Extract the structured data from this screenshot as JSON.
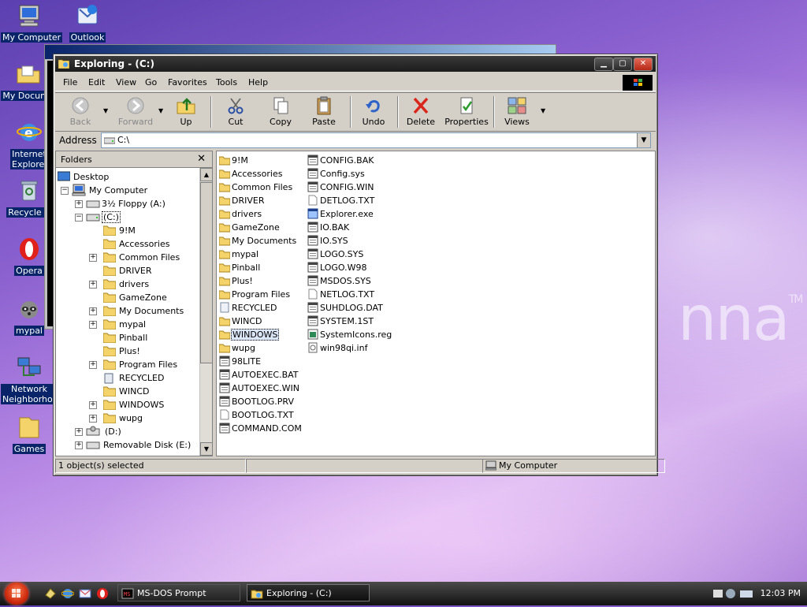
{
  "brand": {
    "text": "nna",
    "tm": "TM"
  },
  "desktop_icons": [
    {
      "label": "My Computer"
    },
    {
      "label": "Outlook"
    },
    {
      "label": "My Docume"
    },
    {
      "label": "Internet Explorer"
    },
    {
      "label": "Recycle B"
    },
    {
      "label": "Opera"
    },
    {
      "label": "mypal"
    },
    {
      "label": "Network Neighborhood"
    },
    {
      "label": "Games"
    }
  ],
  "explorer": {
    "title": "Exploring - (C:)",
    "menu": [
      "File",
      "Edit",
      "View",
      "Go",
      "Favorites",
      "Tools",
      "Help"
    ],
    "toolbar": {
      "back": "Back",
      "forward": "Forward",
      "up": "Up",
      "cut": "Cut",
      "copy": "Copy",
      "paste": "Paste",
      "undo": "Undo",
      "delete": "Delete",
      "properties": "Properties",
      "views": "Views"
    },
    "address": {
      "label": "Address",
      "value": "C:\\"
    },
    "folders_header": "Folders",
    "tree": {
      "desktop": "Desktop",
      "my_computer": "My Computer",
      "floppy": "3½ Floppy (A:)",
      "c_drive": "(C:)",
      "c_children": [
        "9!M",
        "Accessories",
        "Common Files",
        "DRIVER",
        "drivers",
        "GameZone",
        "My Documents",
        "mypal",
        "Pinball",
        "Plus!",
        "Program Files",
        "RECYCLED",
        "WINCD",
        "WINDOWS",
        "wupg"
      ],
      "d_drive": "(D:)",
      "removable": "Removable Disk (E:)"
    },
    "files_col1": [
      "9!M",
      "Accessories",
      "Common Files",
      "DRIVER",
      "drivers",
      "GameZone",
      "My Documents",
      "mypal",
      "Pinball",
      "Plus!",
      "Program Files",
      "RECYCLED",
      "WINCD",
      "WINDOWS",
      "wupg",
      "98LITE",
      "AUTOEXEC.BAT",
      "AUTOEXEC.WIN",
      "BOOTLOG.PRV",
      "BOOTLOG.TXT",
      "COMMAND.COM"
    ],
    "files_col2": [
      "CONFIG.BAK",
      "Config.sys",
      "CONFIG.WIN",
      "DETLOG.TXT",
      "Explorer.exe",
      "IO.BAK",
      "IO.SYS",
      "LOGO.SYS",
      "LOGO.W98",
      "MSDOS.SYS",
      "NETLOG.TXT",
      "SUHDLOG.DAT",
      "SYSTEM.1ST",
      "SystemIcons.reg",
      "win98qi.inf"
    ],
    "selected_file": "WINDOWS",
    "status": {
      "selection": "1 object(s) selected",
      "location": "My Computer"
    }
  },
  "taskbar": {
    "tasks": [
      {
        "label": "MS-DOS Prompt"
      },
      {
        "label": "Exploring - (C:)"
      }
    ],
    "clock": "12:03 PM"
  }
}
